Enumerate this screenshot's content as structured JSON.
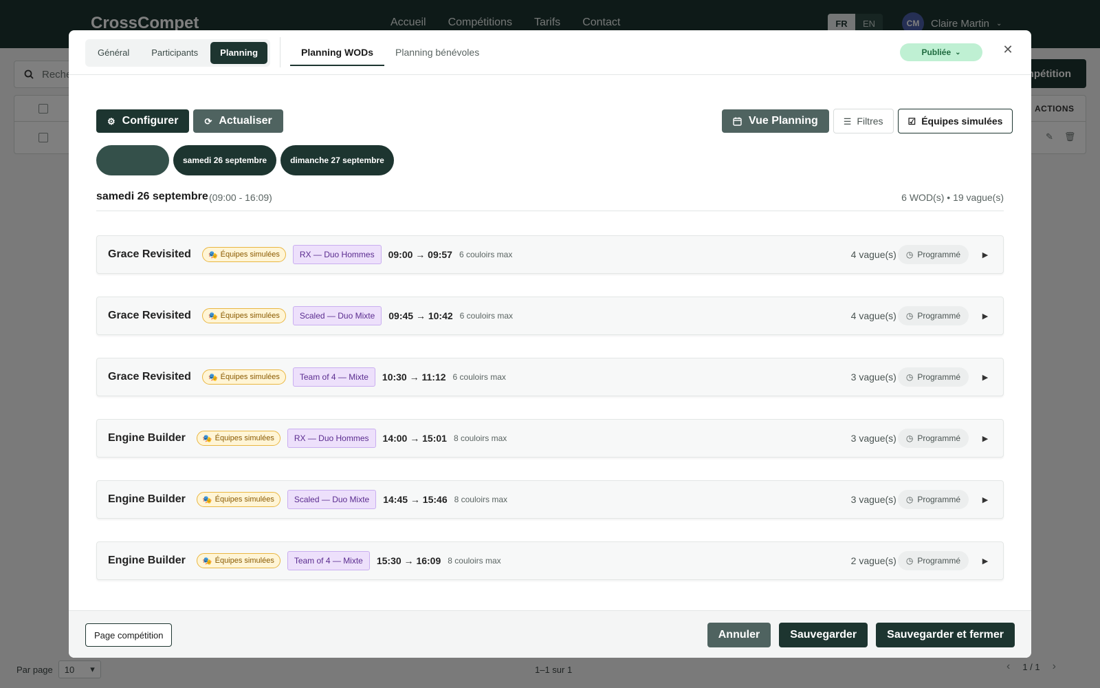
{
  "app": {
    "brand": "CrossCompet",
    "nav": [
      "Accueil",
      "Compétitions",
      "Tarifs",
      "Contact"
    ],
    "languages": [
      "FR",
      "EN"
    ],
    "active_language": "FR",
    "user": {
      "initials": "CM",
      "name": "Claire Martin"
    }
  },
  "background": {
    "search_placeholder": "Recher",
    "new_button_label": "mpétition",
    "table_actions_header": "ACTIONS",
    "per_page_label": "Par page",
    "per_page_value": "10",
    "range_text": "1–1 sur 1",
    "page_text": "1 / 1"
  },
  "modal": {
    "main_tabs": [
      {
        "label": "Général",
        "active": false
      },
      {
        "label": "Participants",
        "active": false
      },
      {
        "label": "Planning",
        "active": true
      }
    ],
    "sub_tabs": [
      {
        "label": "Planning WODs",
        "active": true
      },
      {
        "label": "Planning bénévoles",
        "active": false
      }
    ],
    "status": "Publiée",
    "toolbar": {
      "configure_label": "Configurer",
      "refresh_label": "Actualiser",
      "planning_view_label": "Vue Planning",
      "filters_label": "Filtres",
      "simulated_teams_label": "Équipes simulées"
    },
    "day_chips": [
      "",
      "samedi 26 septembre",
      "dimanche 27 septembre"
    ],
    "day": {
      "title": "samedi 26 septembre",
      "hours": "(09:00 - 16:09)",
      "summary": "6 WOD(s) • 19 vague(s)"
    },
    "wods": [
      {
        "name": "Grace Revisited",
        "sim_badge": "Équipes simulées",
        "category": "RX — Duo Hommes",
        "time": "09:00 → 09:57",
        "lanes": "6 couloirs max",
        "waves": "4 vague(s)",
        "status": "Programmé"
      },
      {
        "name": "Grace Revisited",
        "sim_badge": "Équipes simulées",
        "category": "Scaled — Duo Mixte",
        "time": "09:45 → 10:42",
        "lanes": "6 couloirs max",
        "waves": "4 vague(s)",
        "status": "Programmé"
      },
      {
        "name": "Grace Revisited",
        "sim_badge": "Équipes simulées",
        "category": "Team of 4 — Mixte",
        "time": "10:30 → 11:12",
        "lanes": "6 couloirs max",
        "waves": "3 vague(s)",
        "status": "Programmé"
      },
      {
        "name": "Engine Builder",
        "sim_badge": "Équipes simulées",
        "category": "RX — Duo Hommes",
        "time": "14:00 → 15:01",
        "lanes": "8 couloirs max",
        "waves": "3 vague(s)",
        "status": "Programmé"
      },
      {
        "name": "Engine Builder",
        "sim_badge": "Équipes simulées",
        "category": "Scaled — Duo Mixte",
        "time": "14:45 → 15:46",
        "lanes": "8 couloirs max",
        "waves": "3 vague(s)",
        "status": "Programmé"
      },
      {
        "name": "Engine Builder",
        "sim_badge": "Équipes simulées",
        "category": "Team of 4 — Mixte",
        "time": "15:30 → 16:09",
        "lanes": "8 couloirs max",
        "waves": "2 vague(s)",
        "status": "Programmé"
      }
    ],
    "footer": {
      "page_button": "Page compétition",
      "cancel": "Annuler",
      "save": "Sauvegarder",
      "save_close": "Sauvegarder et fermer"
    }
  },
  "colors": {
    "primary": "#1d3530",
    "slate": "#4f6360",
    "published_bg": "#bff0d3",
    "sim_badge": "#e9b640",
    "category_bg": "#ede0fb"
  }
}
